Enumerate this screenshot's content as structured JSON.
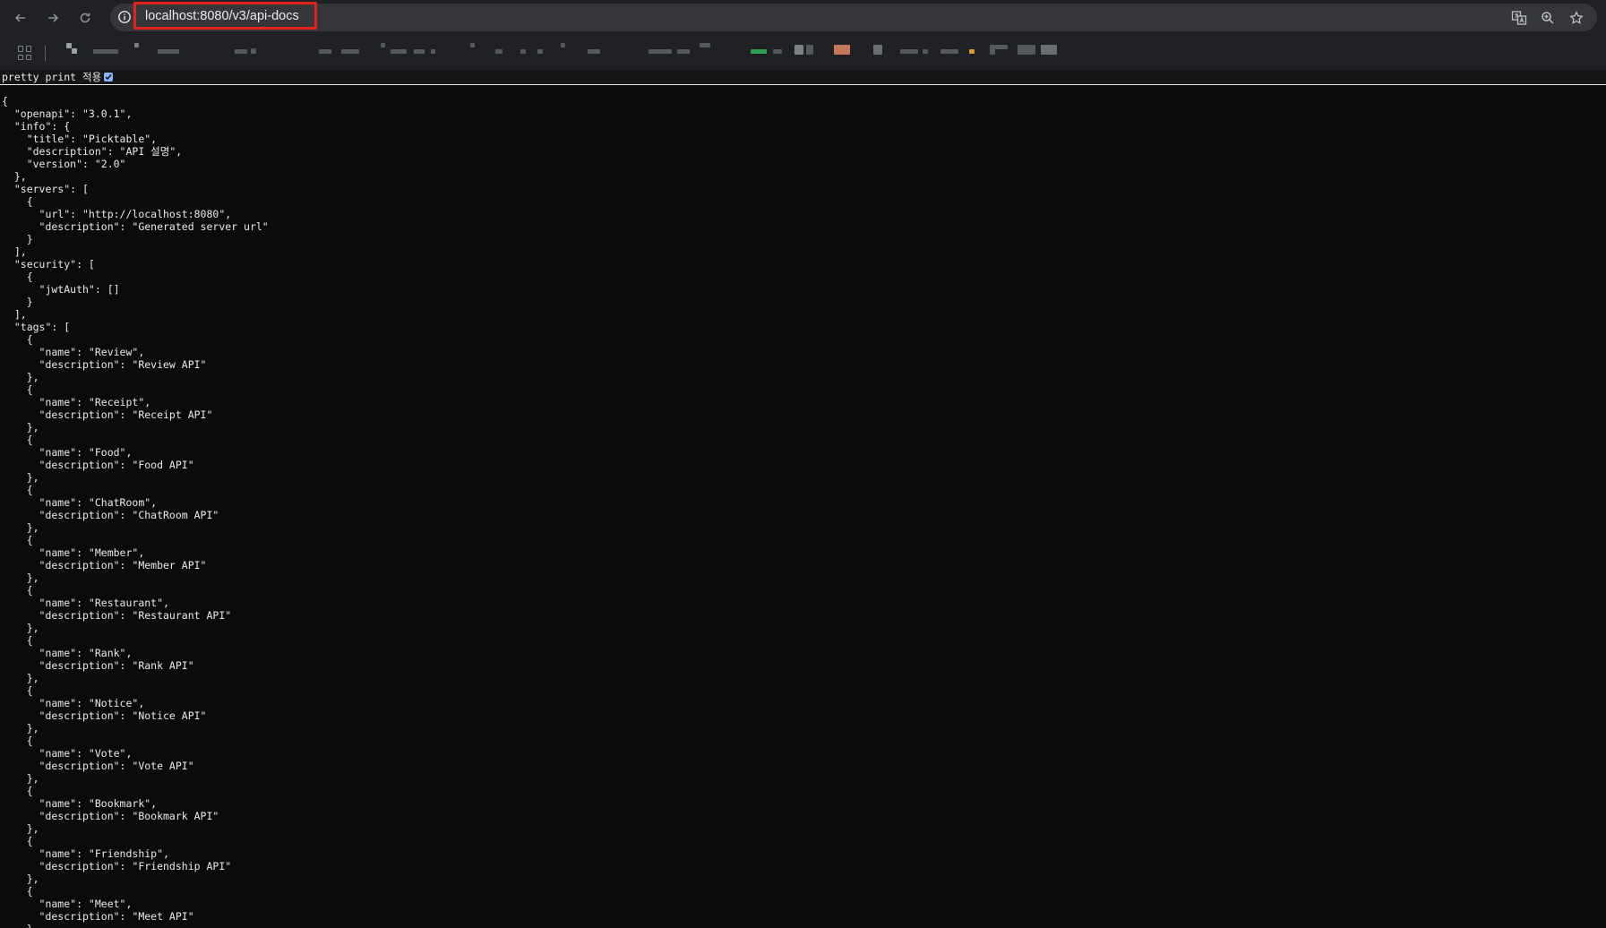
{
  "browser": {
    "url": "localhost:8080/v3/api-docs",
    "icons": {
      "back": "arrow-left-icon",
      "forward": "arrow-right-icon",
      "reload": "reload-icon",
      "site_info": "info-icon",
      "translate": "translate-icon",
      "zoom": "zoom-icon",
      "bookmark": "star-icon",
      "apps": "apps-grid-icon"
    }
  },
  "pretty_print": {
    "label": "pretty print 적용",
    "checked": true
  },
  "json_lines": [
    "{",
    "  \"openapi\": \"3.0.1\",",
    "  \"info\": {",
    "    \"title\": \"Picktable\",",
    "    \"description\": \"API 설명\",",
    "    \"version\": \"2.0\"",
    "  },",
    "  \"servers\": [",
    "    {",
    "      \"url\": \"http://localhost:8080\",",
    "      \"description\": \"Generated server url\"",
    "    }",
    "  ],",
    "  \"security\": [",
    "    {",
    "      \"jwtAuth\": []",
    "    }",
    "  ],",
    "  \"tags\": [",
    "    {",
    "      \"name\": \"Review\",",
    "      \"description\": \"Review API\"",
    "    },",
    "    {",
    "      \"name\": \"Receipt\",",
    "      \"description\": \"Receipt API\"",
    "    },",
    "    {",
    "      \"name\": \"Food\",",
    "      \"description\": \"Food API\"",
    "    },",
    "    {",
    "      \"name\": \"ChatRoom\",",
    "      \"description\": \"ChatRoom API\"",
    "    },",
    "    {",
    "      \"name\": \"Member\",",
    "      \"description\": \"Member API\"",
    "    },",
    "    {",
    "      \"name\": \"Restaurant\",",
    "      \"description\": \"Restaurant API\"",
    "    },",
    "    {",
    "      \"name\": \"Rank\",",
    "      \"description\": \"Rank API\"",
    "    },",
    "    {",
    "      \"name\": \"Notice\",",
    "      \"description\": \"Notice API\"",
    "    },",
    "    {",
    "      \"name\": \"Vote\",",
    "      \"description\": \"Vote API\"",
    "    },",
    "    {",
    "      \"name\": \"Bookmark\",",
    "      \"description\": \"Bookmark API\"",
    "    },",
    "    {",
    "      \"name\": \"Friendship\",",
    "      \"description\": \"Friendship API\"",
    "    },",
    "    {",
    "      \"name\": \"Meet\",",
    "      \"description\": \"Meet API\"",
    "    },"
  ]
}
